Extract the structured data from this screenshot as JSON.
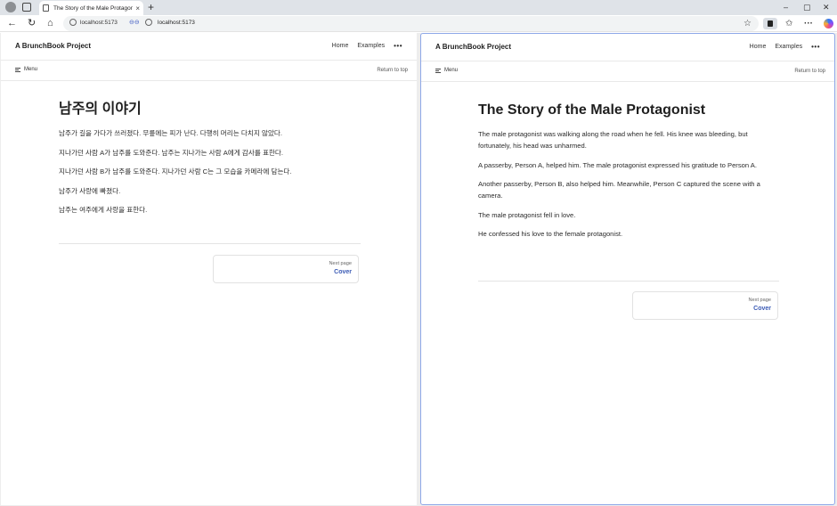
{
  "browser": {
    "tab_title": "The Story of the Male Protagonist",
    "tab_close": "×",
    "new_tab": "+",
    "url_left": "localhost:5173",
    "url_right": "localhost:5173",
    "split_icon": "⊖⊖",
    "win_min": "–",
    "win_max": "▢",
    "win_close": "✕"
  },
  "left": {
    "site_title": "A BrunchBook Project",
    "nav_home": "Home",
    "nav_examples": "Examples",
    "nav_more": "•••",
    "menu": "Menu",
    "return_top": "Return to top",
    "heading": "남주의 이야기",
    "paragraphs": [
      "남주가 길을 가다가 쓰러졌다. 무릎에는 피가 난다. 다행히 머리는 다치지 않았다.",
      "지나가던 사람 A가 남주를 도와준다. 남주는 지나가는 사람 A에게 감사를 표한다.",
      "지나가던 사람 B가 남주를 도와준다. 지나가던 사람 C는 그 모습을 카메라에 담는다.",
      "남주가 사랑에 빠졌다.",
      "남주는 여주에게 사랑을 표한다."
    ],
    "next_label": "Next page",
    "next_title": "Cover"
  },
  "right": {
    "site_title": "A BrunchBook Project",
    "nav_home": "Home",
    "nav_examples": "Examples",
    "nav_more": "•••",
    "menu": "Menu",
    "return_top": "Return to top",
    "heading": "The Story of the Male Protagonist",
    "paragraphs": [
      "The male protagonist was walking along the road when he fell. His knee was bleeding, but fortunately, his head was unharmed.",
      "A passerby, Person A, helped him. The male protagonist expressed his gratitude to Person A.",
      "Another passerby, Person B, also helped him. Meanwhile, Person C captured the scene with a camera.",
      "The male protagonist fell in love.",
      "He confessed his love to the female protagonist."
    ],
    "next_label": "Next page",
    "next_title": "Cover"
  },
  "colors": {
    "accent_link": "#3b5bb5",
    "active_pane_border": "#8ea8e8"
  }
}
